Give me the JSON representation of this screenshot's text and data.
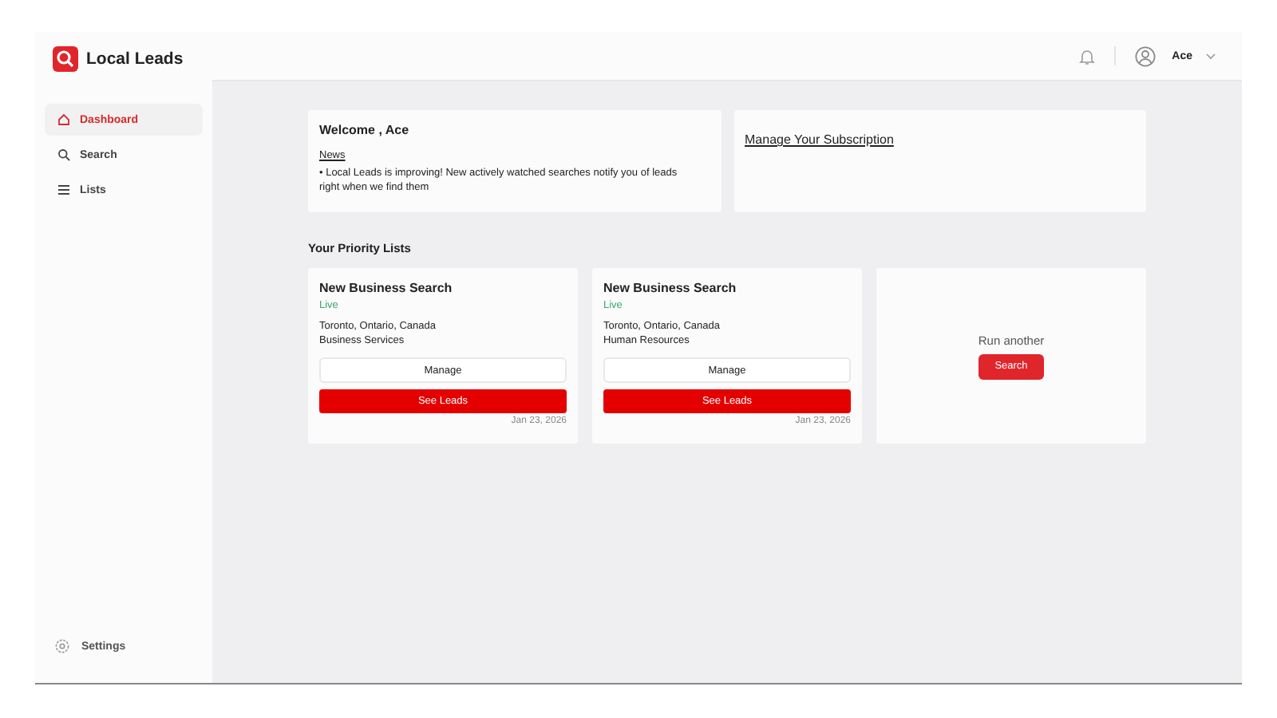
{
  "brand": {
    "name": "Local Leads"
  },
  "sidebar": {
    "items": [
      {
        "label": "Dashboard",
        "kind": "home",
        "selected": true
      },
      {
        "label": "Search",
        "kind": "search",
        "selected": false
      },
      {
        "label": "Lists",
        "kind": "list",
        "selected": false
      }
    ],
    "footer": {
      "label": "Settings"
    }
  },
  "header": {
    "user": "Ace"
  },
  "welcome": {
    "title": "Welcome , Ace",
    "news_heading": "News",
    "news_text": "• Local Leads is improving! New actively watched searches notify you of leads right when we find them"
  },
  "subscription": {
    "link": "Manage Your Subscription"
  },
  "priority_lists": {
    "title": "Your Priority Lists",
    "cards": [
      {
        "title": "New Business Search",
        "status": "Live",
        "location": "Toronto, Ontario, Canada",
        "category": "Business Services",
        "manage": "Manage",
        "see": "See Leads",
        "date": "Jan 23, 2026"
      },
      {
        "title": "New Business Search",
        "status": "Live",
        "location": "Toronto, Ontario, Canada",
        "category": "Human Resources",
        "manage": "Manage",
        "see": "See Leads",
        "date": "Jan 23, 2026"
      }
    ],
    "run_another": {
      "text": "Run another",
      "button": "Search"
    }
  }
}
